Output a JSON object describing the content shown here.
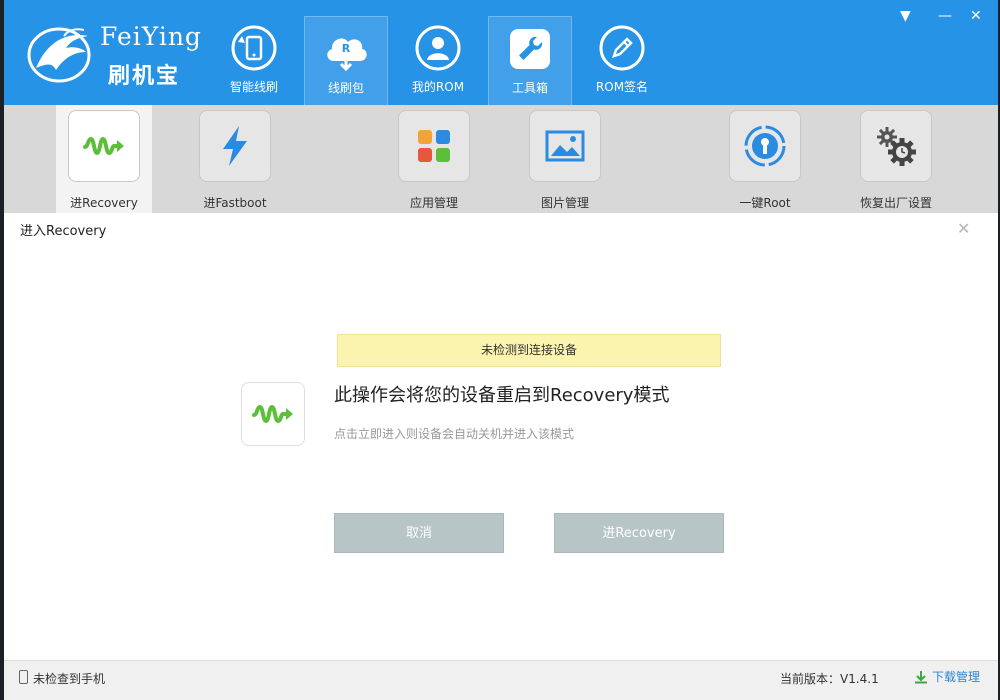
{
  "app": {
    "logo_en": "FeiYing",
    "logo_cn": "刷机宝"
  },
  "nav": [
    {
      "label": "智能线刷",
      "icon": "phone-refresh-icon"
    },
    {
      "label": "线刷包",
      "icon": "cloud-download-icon"
    },
    {
      "label": "我的ROM",
      "icon": "user-icon"
    },
    {
      "label": "工具箱",
      "icon": "wrench-icon",
      "active": true
    },
    {
      "label": "ROM签名",
      "icon": "pen-icon"
    }
  ],
  "tools": [
    {
      "label": "进Recovery",
      "icon": "recovery-wave-icon",
      "active": true
    },
    {
      "label": "进Fastboot",
      "icon": "lightning-icon"
    },
    {
      "label": "应用管理",
      "icon": "apps-grid-icon"
    },
    {
      "label": "图片管理",
      "icon": "image-icon"
    },
    {
      "label": "一键Root",
      "icon": "root-key-icon"
    },
    {
      "label": "恢复出厂设置",
      "icon": "gears-icon"
    }
  ],
  "dialog": {
    "title": "进入Recovery",
    "alert": "未检测到连接设备",
    "heading": "此操作会将您的设备重启到Recovery模式",
    "subtext": "点击立即进入则设备会自动关机并进入该模式",
    "cancel_label": "取消",
    "confirm_label": "进Recovery"
  },
  "status": {
    "phone_status": "未检查到手机",
    "version": "当前版本：V1.4.1",
    "download_label": "下载管理"
  },
  "colors": {
    "header": "#2793e6",
    "toolbar": "#d8d8d8",
    "alert": "#fbf4ae",
    "button": "#b7c5c7",
    "accent_green": "#5bbf3a"
  }
}
